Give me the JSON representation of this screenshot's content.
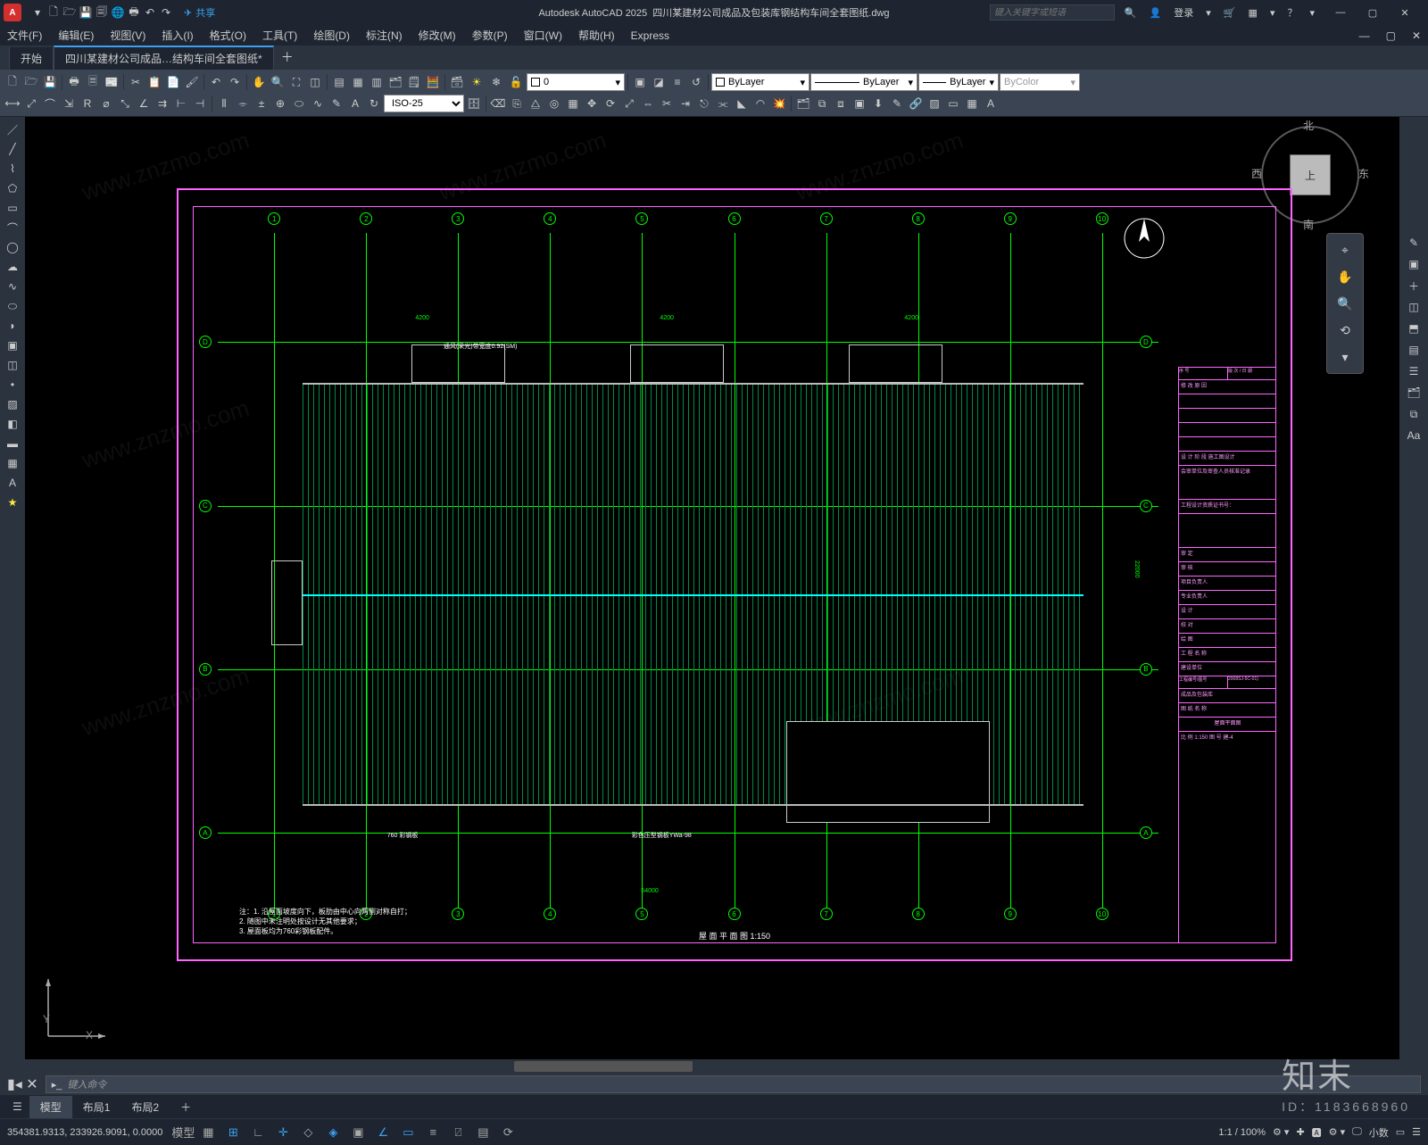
{
  "title": {
    "app": "Autodesk AutoCAD 2025",
    "file": "四川某建材公司成品及包装库钢结构车间全套图纸.dwg"
  },
  "search_placeholder": "键入关键字或短语",
  "login": "登录",
  "share": "共享",
  "menubar": [
    "文件(F)",
    "编辑(E)",
    "视图(V)",
    "插入(I)",
    "格式(O)",
    "工具(T)",
    "绘图(D)",
    "标注(N)",
    "修改(M)",
    "参数(P)",
    "窗口(W)",
    "帮助(H)",
    "Express"
  ],
  "tabs": {
    "start": "开始",
    "doc": "四川某建材公司成品…结构车间全套图纸*"
  },
  "dimstyle": "ISO-25",
  "layer": {
    "value": "0"
  },
  "props": {
    "color": "ByLayer",
    "linetype": "ByLayer",
    "lineweight": "ByLayer",
    "plotstyle": "ByColor"
  },
  "viewcube": {
    "n": "北",
    "s": "南",
    "e": "东",
    "w": "西",
    "face": "上"
  },
  "cmd_placeholder": "键入命令",
  "layouts": {
    "model": "模型",
    "l1": "布局1",
    "l2": "布局2"
  },
  "status": {
    "coords": "354381.9313, 233926.9091, 0.0000",
    "space": "模型",
    "scale": "1:1 / 100%",
    "units": "小数"
  },
  "plan": {
    "cols": [
      "1",
      "2",
      "3",
      "4",
      "5",
      "6",
      "7",
      "8",
      "9",
      "10"
    ],
    "rows": [
      "A",
      "B",
      "C",
      "D"
    ],
    "title": "屋 面 平 面 图   1:150",
    "hatch_labels": [
      "4200",
      "4200",
      "4200"
    ],
    "ridge_label": "通风(采光)带宽度0.92(SM)",
    "roof_note": "彩色压型钢板YWa-98",
    "gutter_note": "760 彩钢板",
    "dim_total": "54000",
    "dim_side": "22000",
    "notes": [
      "注：1. 沿屋面坡度向下，板肋由中心向两侧对称自打；",
      "    2. 随图中未注明处按设计无其他要求；",
      "    3. 屋面板均为760彩钢板配件。"
    ]
  },
  "titleblock": {
    "head": [
      "序 号",
      "版 次 / 日 期",
      "修 改 原 因"
    ],
    "stage": "设 计 阶 段        施工图设计",
    "owner": "会审单位及审查人员核准记录",
    "cert": "工程设计资质证书号：",
    "proj_label": "工 程 名 称",
    "client_label": "建设单位",
    "roles": [
      "审 定",
      "审 核",
      "项目负责人",
      "专业负责人",
      "设 计",
      "校 对",
      "绘 图"
    ],
    "draw": "图 纸 名 称",
    "draw_name": "屋面平面图",
    "no_label": "工程编号/图号",
    "no": "2008SJ-5C-01)",
    "sub": "成品及包装库",
    "scale": "比 例  1:150   图 号  建-4"
  },
  "brand": {
    "name": "知末",
    "id": "ID：1183668960"
  }
}
